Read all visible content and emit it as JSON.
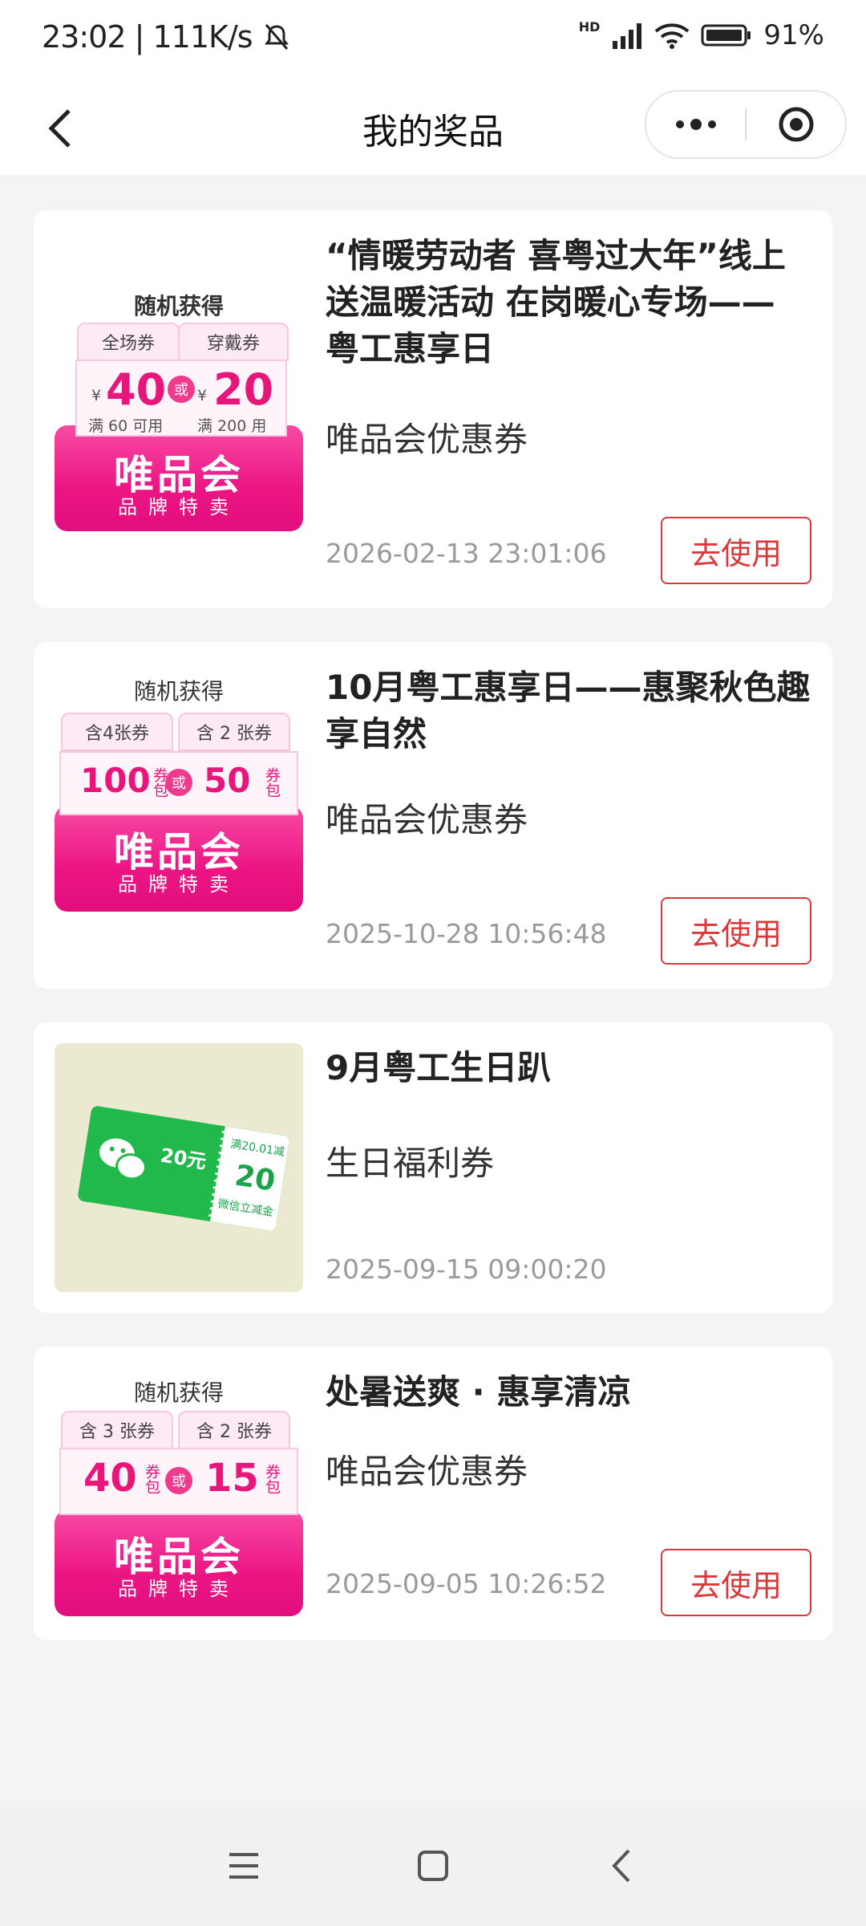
{
  "status": {
    "time": "23:02",
    "speed": "111K/s",
    "battery": "91%",
    "hd": "HD"
  },
  "nav": {
    "title": "我的奖品"
  },
  "vip": {
    "head": "随机获得",
    "brand": "唯品会",
    "slogan": "品牌特卖",
    "or": "或",
    "currency": "¥",
    "pack": "券包"
  },
  "prizes": [
    {
      "title": "“情暖劳动者 喜粤过大年”线上送温暖活动 在岗暖心专场—— 粤工惠享日",
      "type": "唯品会优惠券",
      "time": "2026-02-13 23:01:06",
      "button": "去使用",
      "tabs": [
        "全场券",
        "穿戴券"
      ],
      "amounts": [
        "40",
        "20"
      ],
      "subs": [
        "满 60 可用",
        "满 200 用"
      ]
    },
    {
      "title": "10月粤工惠享日——惠聚秋色趣享自然",
      "type": "唯品会优惠券",
      "time": "2025-10-28 10:56:48",
      "button": "去使用",
      "tabs": [
        "含4张券",
        "含 2 张券"
      ],
      "amounts": [
        "100",
        "50"
      ]
    },
    {
      "title": "9月粤工生日趴",
      "type": "生日福利券",
      "time": "2025-09-15 09:00:20",
      "wx": {
        "value": "20元",
        "big": "20",
        "cond": "满20.01减",
        "label": "微信立减金"
      }
    },
    {
      "title": "处暑送爽 · 惠享清凉",
      "type": "唯品会优惠券",
      "time": "2025-09-05 10:26:52",
      "button": "去使用",
      "tabs": [
        "含 3 张券",
        "含 2 张券"
      ],
      "amounts": [
        "40",
        "15"
      ]
    }
  ]
}
